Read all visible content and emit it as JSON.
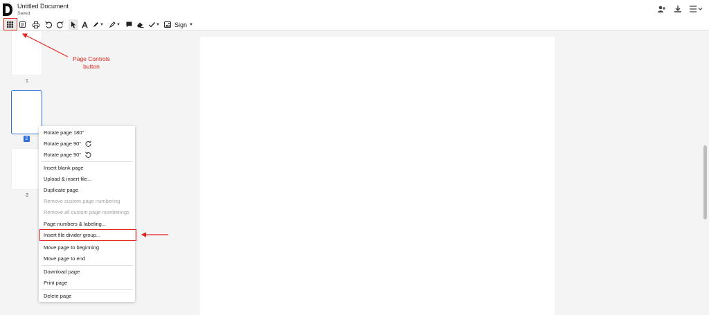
{
  "header": {
    "title": "Untitled Document",
    "status": "Saved"
  },
  "toolbar": {
    "sign_label": "Sign"
  },
  "thumbnails": [
    {
      "number": "1"
    },
    {
      "number": "2"
    },
    {
      "number": "3"
    }
  ],
  "context_menu": {
    "items": [
      {
        "label": "Rotate page 180°"
      },
      {
        "label": "Rotate page 90°"
      },
      {
        "label": "Rotate page 90°"
      },
      {
        "label": "Insert blank page"
      },
      {
        "label": "Upload & insert file..."
      },
      {
        "label": "Duplicate page"
      },
      {
        "label": "Remove custom page numbering"
      },
      {
        "label": "Remove all custom page numberings"
      },
      {
        "label": "Page numbers & labeling..."
      },
      {
        "label": "Insert file divider group..."
      },
      {
        "label": "Move page to beginning"
      },
      {
        "label": "Move page to end"
      },
      {
        "label": "Download page"
      },
      {
        "label": "Print page"
      },
      {
        "label": "Delete page"
      }
    ]
  },
  "annotations": {
    "callout_line1": "Page Controls",
    "callout_line2": "button",
    "color": "#e0261d"
  },
  "colors": {
    "accent": "#2f6fde"
  }
}
